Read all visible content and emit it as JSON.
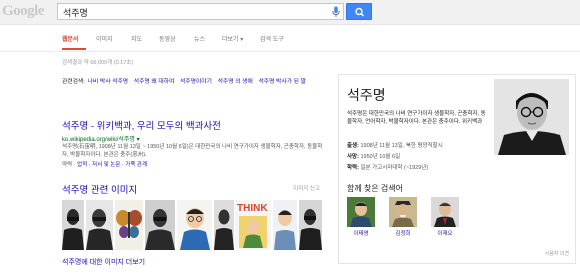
{
  "header": {
    "logo_text": "Google",
    "query": "석주명"
  },
  "tabs": [
    {
      "label": "웹문서",
      "active": true
    },
    {
      "label": "이미지"
    },
    {
      "label": "지도"
    },
    {
      "label": "동영상"
    },
    {
      "label": "뉴스"
    },
    {
      "label": "더보기 ▾"
    },
    {
      "label": "검색 도구"
    }
  ],
  "stats": "검색결과 약 66,000개 (0.17초)",
  "related": {
    "label": "관련검색:",
    "items": [
      "나비 박사 석주명",
      "석주명 왜 대하여",
      "석주명이야기",
      "석주명 의 생애",
      "석주명 박사가 된 말"
    ]
  },
  "result": {
    "title": "석주명 - 위키백과, 우리 모두의 백과사전",
    "url": "ko.wikipedia.org/wiki/석주명 ▾",
    "snippet": "석주명(石宙明, 1908년 11월 13일 ~ 1950년 10월 6일)은 대한민국의 나비 연구가이자 생물학자, 곤충학자, 동물학자, 박물학자이다. 본관은 충주(忠州).",
    "links_label": "약력 ·",
    "links": "업적 · 저서 및 논문 · 가족 관계"
  },
  "images": {
    "title": "석주명 관련 이미지",
    "report": "이미지 신고",
    "more": "석주명에 대한 이미지 더보기"
  },
  "knowledge_panel": {
    "name": "석주명",
    "description": "석주명은 대한민국의 나비 연구가이자 생물학자, 곤충학자, 동물학자, 언어학자, 박물학자이다. 본관은 충주이다. 위키백과",
    "facts": [
      {
        "label": "출생:",
        "value": "1908년 11월 13일, 북한 평양직할시"
      },
      {
        "label": "사망:",
        "value": "1950년 10월 6일"
      },
      {
        "label": "학력:",
        "value": "일본 가고시마대학 (~1929년)"
      }
    ],
    "related_title": "함께 찾은 검색어",
    "people": [
      {
        "name": "이태영"
      },
      {
        "name": "김정희"
      },
      {
        "name": "이재오"
      }
    ],
    "feedback": "사용자 의견"
  },
  "colors": {
    "accent": "#dd4b39",
    "link": "#1a0dab",
    "url": "#006621",
    "button": "#4285f4"
  }
}
